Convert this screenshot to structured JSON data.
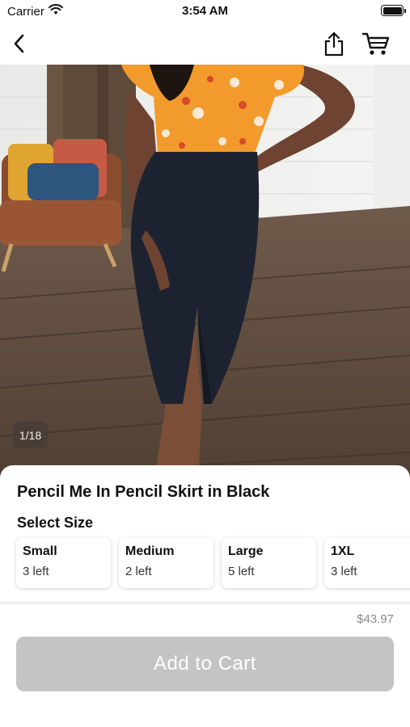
{
  "status": {
    "carrier": "Carrier",
    "time": "3:54 AM",
    "battery_level": 1.0
  },
  "nav": {
    "back_icon": "chevron-left-icon",
    "share_icon": "share-icon",
    "cart_icon": "cart-icon"
  },
  "gallery": {
    "counter": "1/18"
  },
  "product": {
    "title": "Pencil Me In Pencil Skirt in Black",
    "select_size_label": "Select Size",
    "sizes": [
      {
        "name": "Small",
        "stock": "3 left"
      },
      {
        "name": "Medium",
        "stock": "2 left"
      },
      {
        "name": "Large",
        "stock": "5 left"
      },
      {
        "name": "1XL",
        "stock": "3 left"
      }
    ],
    "price": "$43.97",
    "add_to_cart_label": "Add to Cart"
  },
  "colors": {
    "button_disabled": "#c4c4c4",
    "price_text": "#8a8a8a"
  }
}
